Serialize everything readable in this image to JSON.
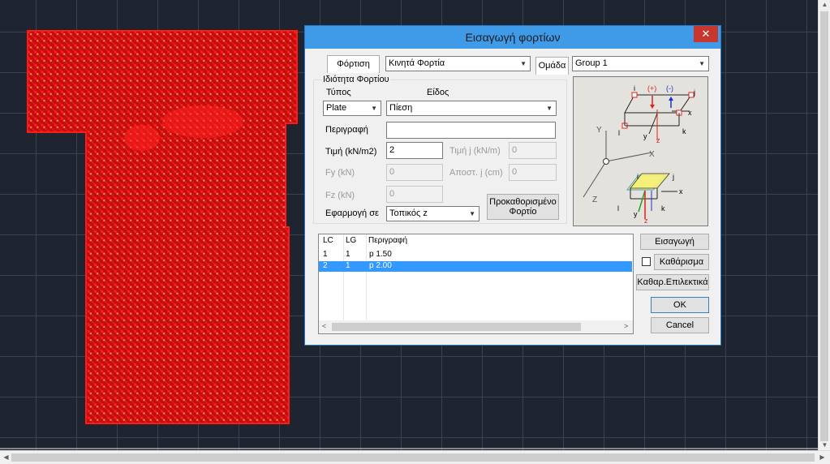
{
  "dialog": {
    "title": "Εισαγωγή φορτίων",
    "close_symbol": "✕",
    "tab_loading": "Φόρτιση",
    "loading_value": "Κινητά Φορτία",
    "tab_group": "Ομάδα",
    "group_value": "Group 1",
    "props_title": "Ιδιότητα Φορτίου",
    "type_label": "Τύπος",
    "kind_label": "Είδος",
    "type_value": "Plate",
    "kind_value": "Πίεση",
    "description_label": "Περιγραφή",
    "description_value": "",
    "value_label": "Τιμή (kN/m2)",
    "value_value": "2",
    "value_j_label": "Τιμή j (kN/m)",
    "value_j_value": "0",
    "fy_label": "Fy (kN)",
    "fy_value": "0",
    "dist_j_label": "Αποστ. j (cm)",
    "dist_j_value": "0",
    "fz_label": "Fz (kN)",
    "fz_value": "0",
    "apply_label": "Εφαρμογή σε",
    "apply_value": "Τοπικός z",
    "predefined_button": [
      "Προκαθορισμένο",
      "Φορτίο"
    ],
    "list": {
      "columns": [
        "LC",
        "LG",
        "Περιγραφή"
      ],
      "rows": [
        {
          "lc": "1",
          "lg": "1",
          "desc": "p  1.50",
          "selected": false
        },
        {
          "lc": "2",
          "lg": "1",
          "desc": "p  2.00",
          "selected": true
        }
      ]
    },
    "buttons": {
      "insert": "Εισαγωγή",
      "clear": "Καθάρισμα",
      "clear_selective": "Καθαρ.Επιλεκτικά",
      "ok": "OK",
      "cancel": "Cancel"
    },
    "diagram": {
      "labels": {
        "i": "i",
        "j": "j",
        "k": "k",
        "l": "l",
        "plus": "(+)",
        "minus": "(-)",
        "x": "x",
        "y": "y",
        "z": "z",
        "X": "X",
        "Y": "Y",
        "Z": "Z"
      },
      "colors": {
        "red": "#e02020",
        "blue": "#2030d0",
        "green": "#20a020",
        "yellow": "#f5f07a",
        "cyan": "#40a0e0"
      }
    }
  },
  "canvas": {
    "colors": {
      "background": "#1f2530",
      "grid": "#3a4250",
      "mesh": "#e01010",
      "node": "#f5e6a0"
    }
  }
}
